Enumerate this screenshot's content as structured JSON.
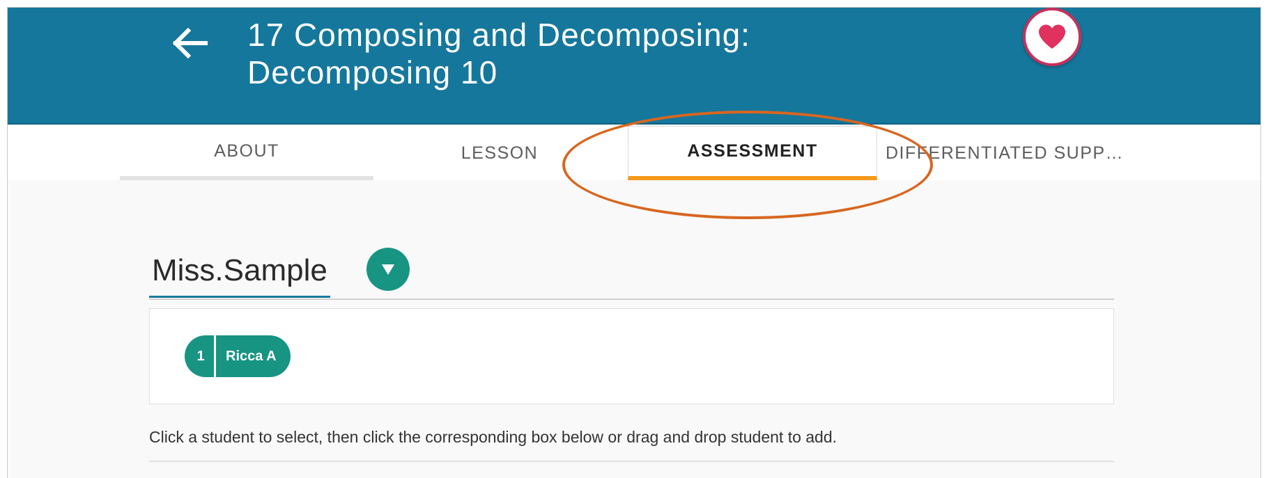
{
  "header": {
    "title": "17 Composing and Decomposing:\nDecomposing 10",
    "back_icon": "arrow-left-icon",
    "favorite_icon": "heart-icon",
    "background_color": "#15779b",
    "favorite_color": "#e0315f"
  },
  "tabs": [
    {
      "label": "ABOUT",
      "active": false
    },
    {
      "label": "LESSON",
      "active": false
    },
    {
      "label": "ASSESSMENT",
      "active": true
    },
    {
      "label": "DIFFERENTIATED SUPP…",
      "active": false
    }
  ],
  "accent_color": "#f59a1b",
  "annotation_color": "#d8661f",
  "class_selector": {
    "name": "Miss.Sample",
    "dropdown_icon": "triangle-down-icon",
    "color": "#179482"
  },
  "students": [
    {
      "number": "1",
      "name": "Ricca A"
    }
  ],
  "instructions": "Click a student to select, then click the corresponding box below or drag and drop student to add."
}
